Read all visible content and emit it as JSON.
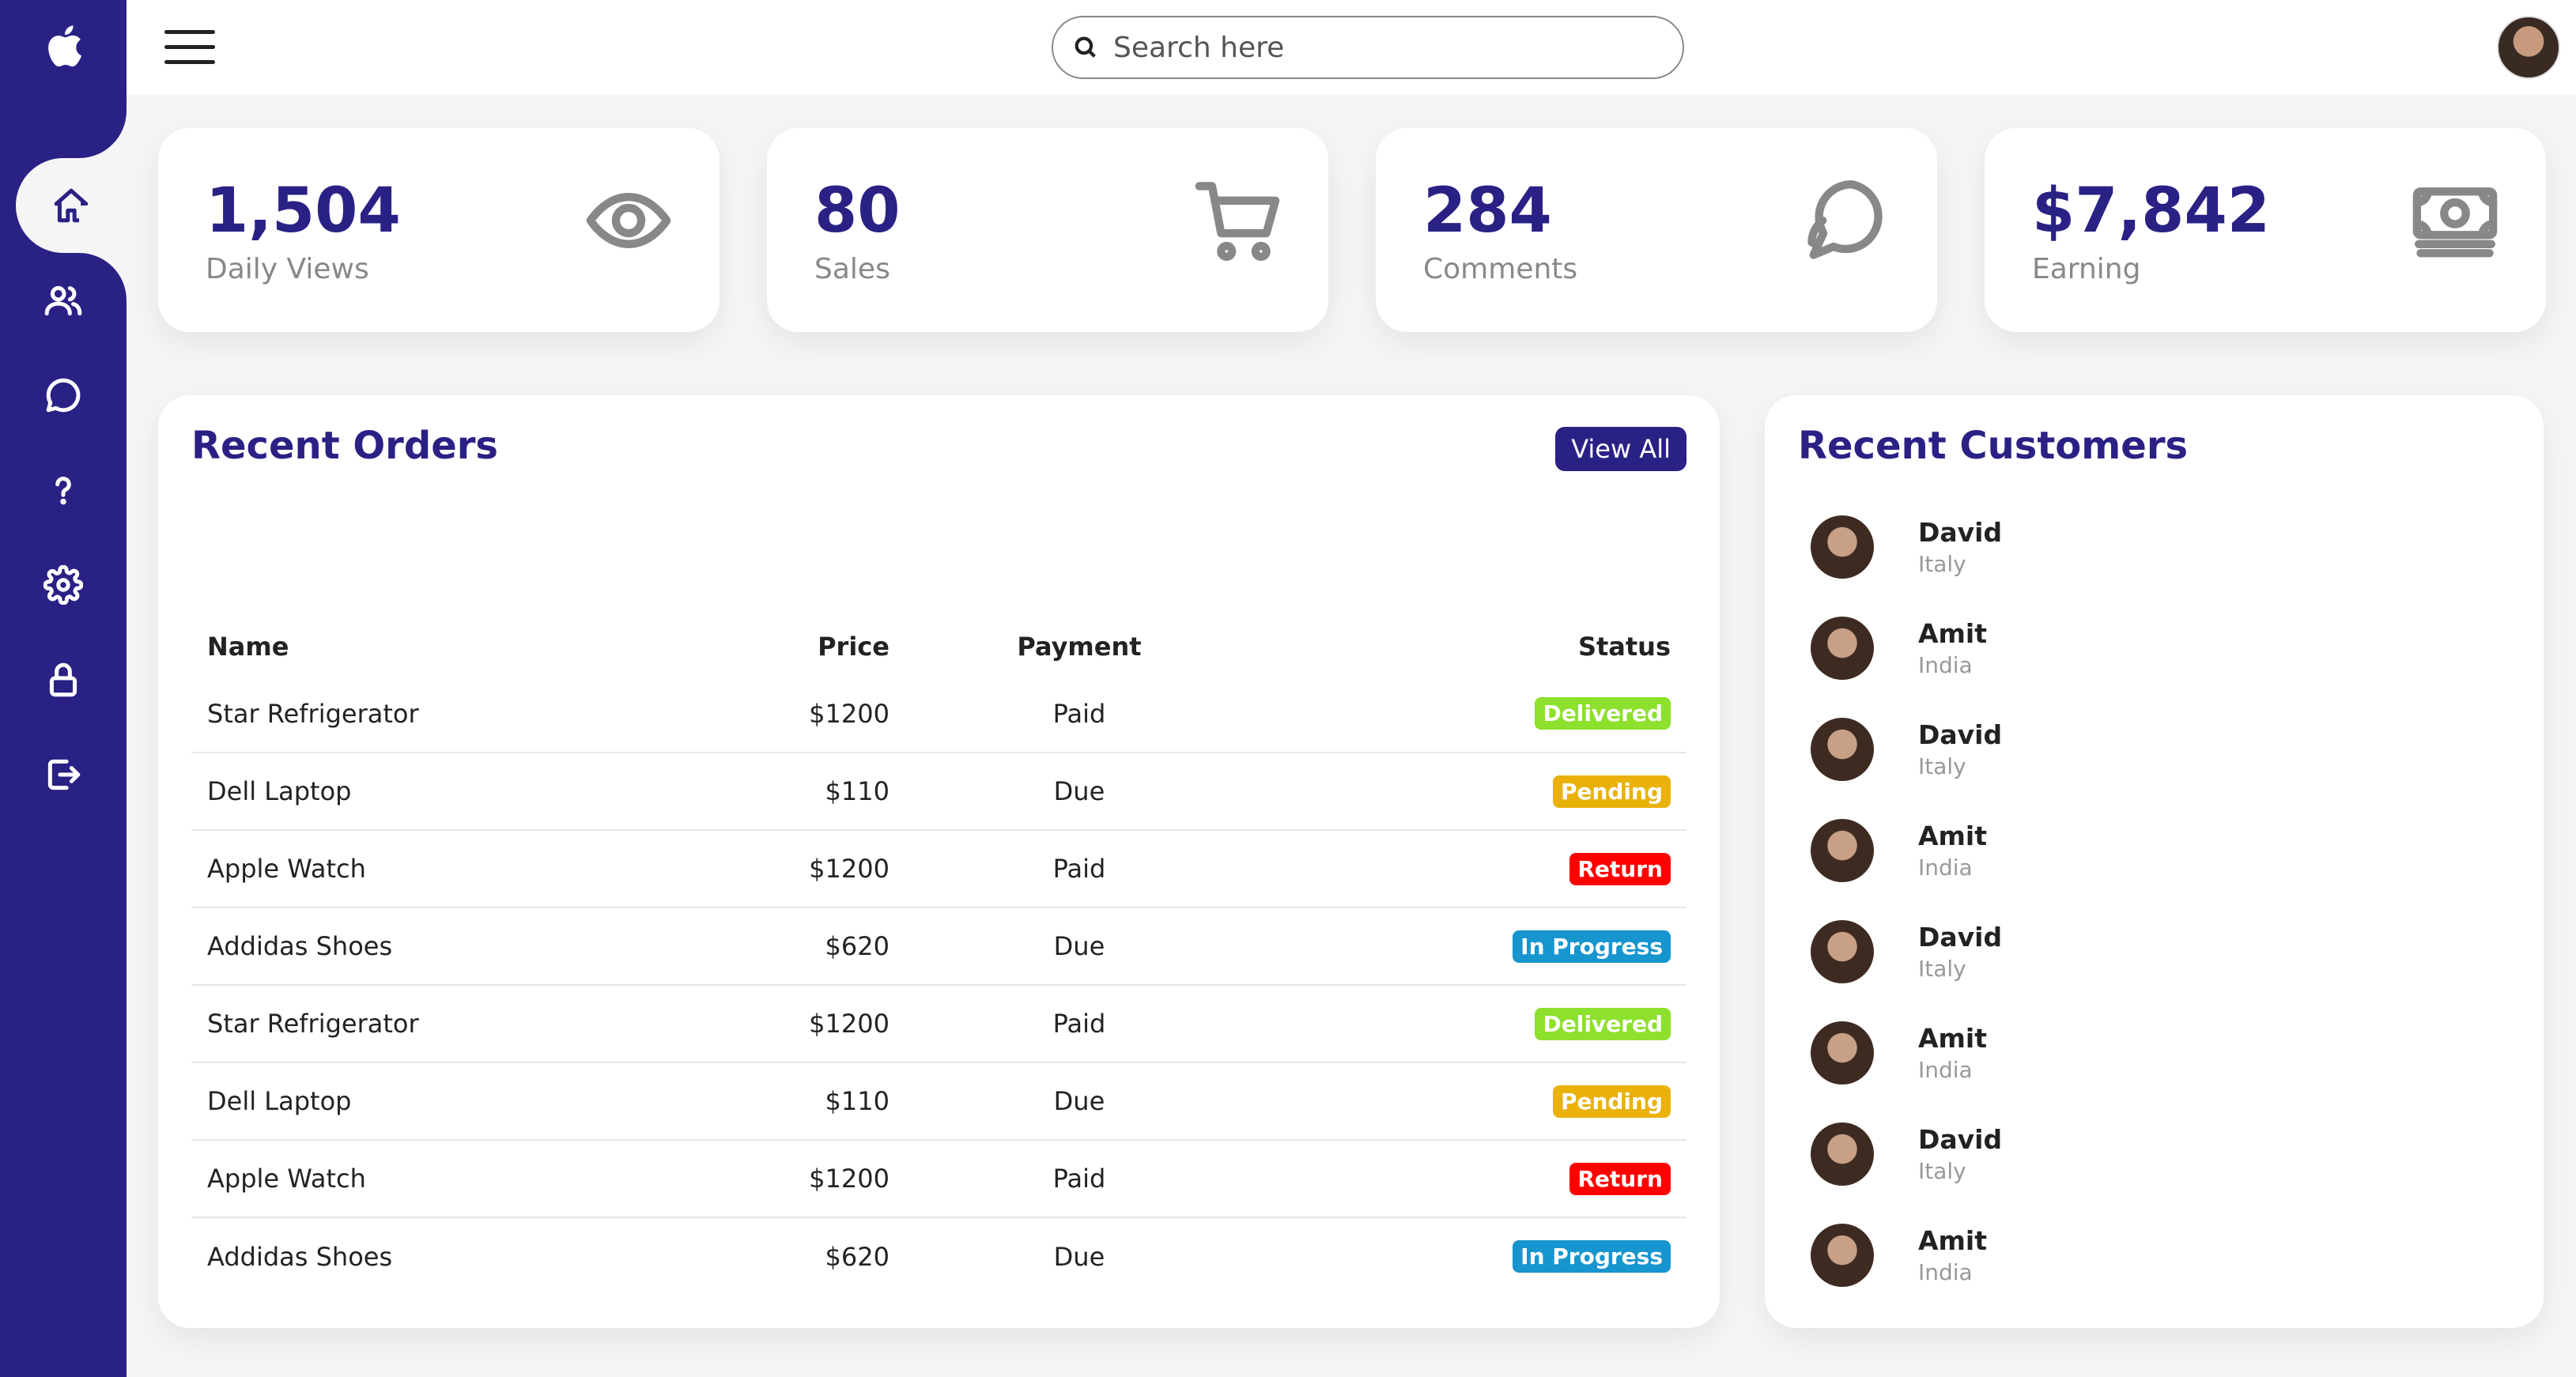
{
  "sidebar": {
    "logo_icon": "apple-logo-icon",
    "items": [
      {
        "id": "dashboard",
        "icon": "home-icon",
        "active": true
      },
      {
        "id": "customers",
        "icon": "people-icon"
      },
      {
        "id": "messages",
        "icon": "chat-icon"
      },
      {
        "id": "help",
        "icon": "help-icon"
      },
      {
        "id": "settings",
        "icon": "gear-icon"
      },
      {
        "id": "password",
        "icon": "lock-icon"
      },
      {
        "id": "signout",
        "icon": "logout-icon"
      }
    ],
    "background": "#2a2185"
  },
  "topbar": {
    "search_placeholder": "Search here"
  },
  "cards": [
    {
      "value": "1,504",
      "label": "Daily Views",
      "icon": "eye-icon"
    },
    {
      "value": "80",
      "label": "Sales",
      "icon": "cart-icon"
    },
    {
      "value": "284",
      "label": "Comments",
      "icon": "comment-icon"
    },
    {
      "value": "$7,842",
      "label": "Earning",
      "icon": "money-icon"
    }
  ],
  "orders": {
    "title": "Recent Orders",
    "view_all": "View All",
    "headers": {
      "name": "Name",
      "price": "Price",
      "payment": "Payment",
      "status": "Status"
    },
    "rows": [
      {
        "name": "Star Refrigerator",
        "price": "$1200",
        "payment": "Paid",
        "status": "Delivered",
        "status_color": "#8de02c"
      },
      {
        "name": "Dell Laptop",
        "price": "$110",
        "payment": "Due",
        "status": "Pending",
        "status_color": "#e9b10a"
      },
      {
        "name": "Apple Watch",
        "price": "$1200",
        "payment": "Paid",
        "status": "Return",
        "status_color": "#f00"
      },
      {
        "name": "Addidas Shoes",
        "price": "$620",
        "payment": "Due",
        "status": "In Progress",
        "status_color": "#1795ce"
      },
      {
        "name": "Star Refrigerator",
        "price": "$1200",
        "payment": "Paid",
        "status": "Delivered",
        "status_color": "#8de02c"
      },
      {
        "name": "Dell Laptop",
        "price": "$110",
        "payment": "Due",
        "status": "Pending",
        "status_color": "#e9b10a"
      },
      {
        "name": "Apple Watch",
        "price": "$1200",
        "payment": "Paid",
        "status": "Return",
        "status_color": "#f00"
      },
      {
        "name": "Addidas Shoes",
        "price": "$620",
        "payment": "Due",
        "status": "In Progress",
        "status_color": "#1795ce"
      }
    ]
  },
  "customers": {
    "title": "Recent Customers",
    "list": [
      {
        "name": "David",
        "country": "Italy"
      },
      {
        "name": "Amit",
        "country": "India"
      },
      {
        "name": "David",
        "country": "Italy"
      },
      {
        "name": "Amit",
        "country": "India"
      },
      {
        "name": "David",
        "country": "Italy"
      },
      {
        "name": "Amit",
        "country": "India"
      },
      {
        "name": "David",
        "country": "Italy"
      },
      {
        "name": "Amit",
        "country": "India"
      }
    ]
  }
}
